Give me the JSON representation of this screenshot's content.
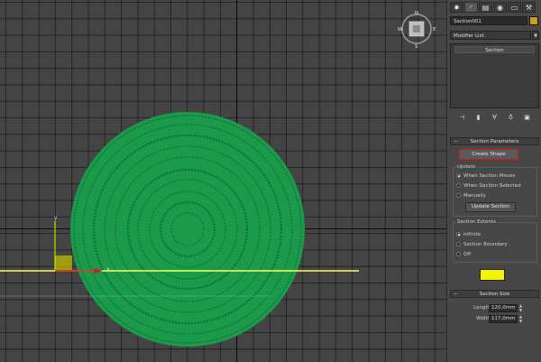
{
  "viewport": {
    "compass": {
      "north": "N",
      "south": "S",
      "east": "E",
      "west": "W"
    },
    "gizmo": {
      "x_label": "x",
      "y_label": "y"
    },
    "colors": {
      "disc_fill": "#1a9a4a",
      "ring_stroke": "#0f6a30",
      "section_line": "#ffff5a",
      "red_axis": "#d02020",
      "green_axis": "#c8e600"
    }
  },
  "panel": {
    "object_name": "Section001",
    "object_color": "#c8a010",
    "modifier_list_label": "Modifier List",
    "stack": {
      "items": [
        "Section"
      ]
    },
    "section_parameters": {
      "title": "Section Parameters",
      "create_shape_label": "Create Shape",
      "update": {
        "label": "Update:",
        "options": [
          "When Section Moves",
          "When Section Selected",
          "Manually"
        ],
        "selected": "When Section Moves",
        "update_button_label": "Update Section"
      },
      "extents": {
        "label": "Section Extents",
        "options": [
          "Infinite",
          "Section Boundary",
          "Off"
        ],
        "selected": "Infinite"
      },
      "color_swatch": "#f5f500"
    },
    "section_size": {
      "title": "Section Size",
      "length_label": "Length:",
      "length_value": "120,0mm",
      "width_label": "Width:",
      "width_value": "117,0mm"
    }
  }
}
